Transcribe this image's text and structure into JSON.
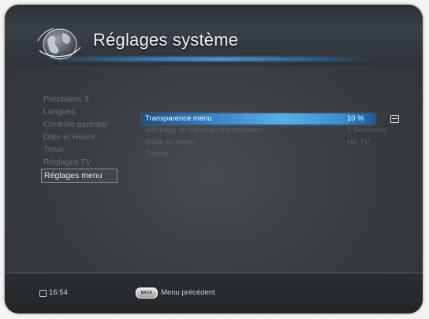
{
  "header": {
    "title": "Réglages système",
    "logo_icon": "globe-icon"
  },
  "side_menu": {
    "items": [
      {
        "label": "Précédent  ⇕",
        "active": false
      },
      {
        "label": "Langues",
        "active": false
      },
      {
        "label": "Contrôle parental",
        "active": false
      },
      {
        "label": "Date et Heure",
        "active": false
      },
      {
        "label": "Timer",
        "active": false
      },
      {
        "label": "Réglages TV",
        "active": false
      },
      {
        "label": "Réglages menu",
        "active": true
      }
    ]
  },
  "settings": {
    "rows": [
      {
        "label": "Transparence menu",
        "value": "10 %",
        "selected": true
      },
      {
        "label": "Affichage du bandeau d'information",
        "value": "5 Secondes",
        "selected": false
      },
      {
        "label": "Mode du menu",
        "value": "HD TV",
        "selected": false
      },
      {
        "label": "Thème",
        "value": "",
        "selected": false
      }
    ],
    "adjust_icon": "slider-adjust-icon"
  },
  "footer": {
    "clock_icon": "clock-icon",
    "time": "16:54",
    "back_key_label": "BACK",
    "back_label": "Menu précédent"
  },
  "colors": {
    "accent": "#3d86c6",
    "highlight": "#5ab0ea",
    "background": "#3a3d41"
  }
}
